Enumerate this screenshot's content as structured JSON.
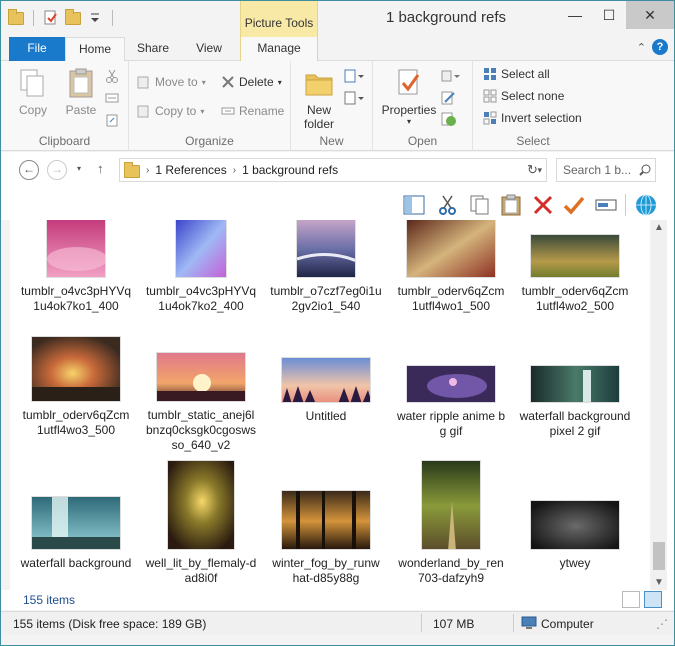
{
  "window": {
    "title": "1 background refs",
    "context_tab": "Picture Tools",
    "controls": {
      "minimize": "—",
      "maximize": "☐",
      "close": "✕"
    }
  },
  "tabs": {
    "file": "File",
    "home": "Home",
    "share": "Share",
    "view": "View",
    "manage": "Manage"
  },
  "ribbon": {
    "clipboard": {
      "label": "Clipboard",
      "copy": "Copy",
      "paste": "Paste"
    },
    "organize": {
      "label": "Organize",
      "move_to": "Move to",
      "copy_to": "Copy to",
      "delete": "Delete",
      "rename": "Rename"
    },
    "new": {
      "label": "New",
      "new_folder_line1": "New",
      "new_folder_line2": "folder"
    },
    "open": {
      "label": "Open",
      "properties": "Properties"
    },
    "select": {
      "label": "Select",
      "select_all": "Select all",
      "select_none": "Select none",
      "invert_selection": "Invert selection"
    }
  },
  "address": {
    "segments": [
      "1 References",
      "1 background refs"
    ],
    "search_placeholder": "Search 1 b..."
  },
  "files": [
    {
      "name": "tumblr_o4vc3pHYVq1u4ok7ko1_400"
    },
    {
      "name": "tumblr_o4vc3pHYVq1u4ok7ko2_400"
    },
    {
      "name": "tumblr_o7czf7eg0i1u2gv2io1_540"
    },
    {
      "name": "tumblr_oderv6qZcm1utfl4wo1_500"
    },
    {
      "name": "tumblr_oderv6qZcm1utfl4wo2_500"
    },
    {
      "name": "tumblr_oderv6qZcm1utfl4wo3_500"
    },
    {
      "name": "tumblr_static_anej6lbnzq0cksgk0cgoswsso_640_v2"
    },
    {
      "name": "Untitled"
    },
    {
      "name": "water ripple anime bg gif"
    },
    {
      "name": "waterfall background pixel 2 gif"
    },
    {
      "name": "waterfall background"
    },
    {
      "name": "well_lit_by_flemaly-dad8i0f"
    },
    {
      "name": "winter_fog_by_runwhat-d85y88g"
    },
    {
      "name": "wonderland_by_ren703-dafzyh9"
    },
    {
      "name": "ytwey"
    }
  ],
  "count_text": "155 items",
  "status": {
    "items": "155 items (Disk free space: 189 GB)",
    "size": "107 MB",
    "location": "Computer"
  }
}
